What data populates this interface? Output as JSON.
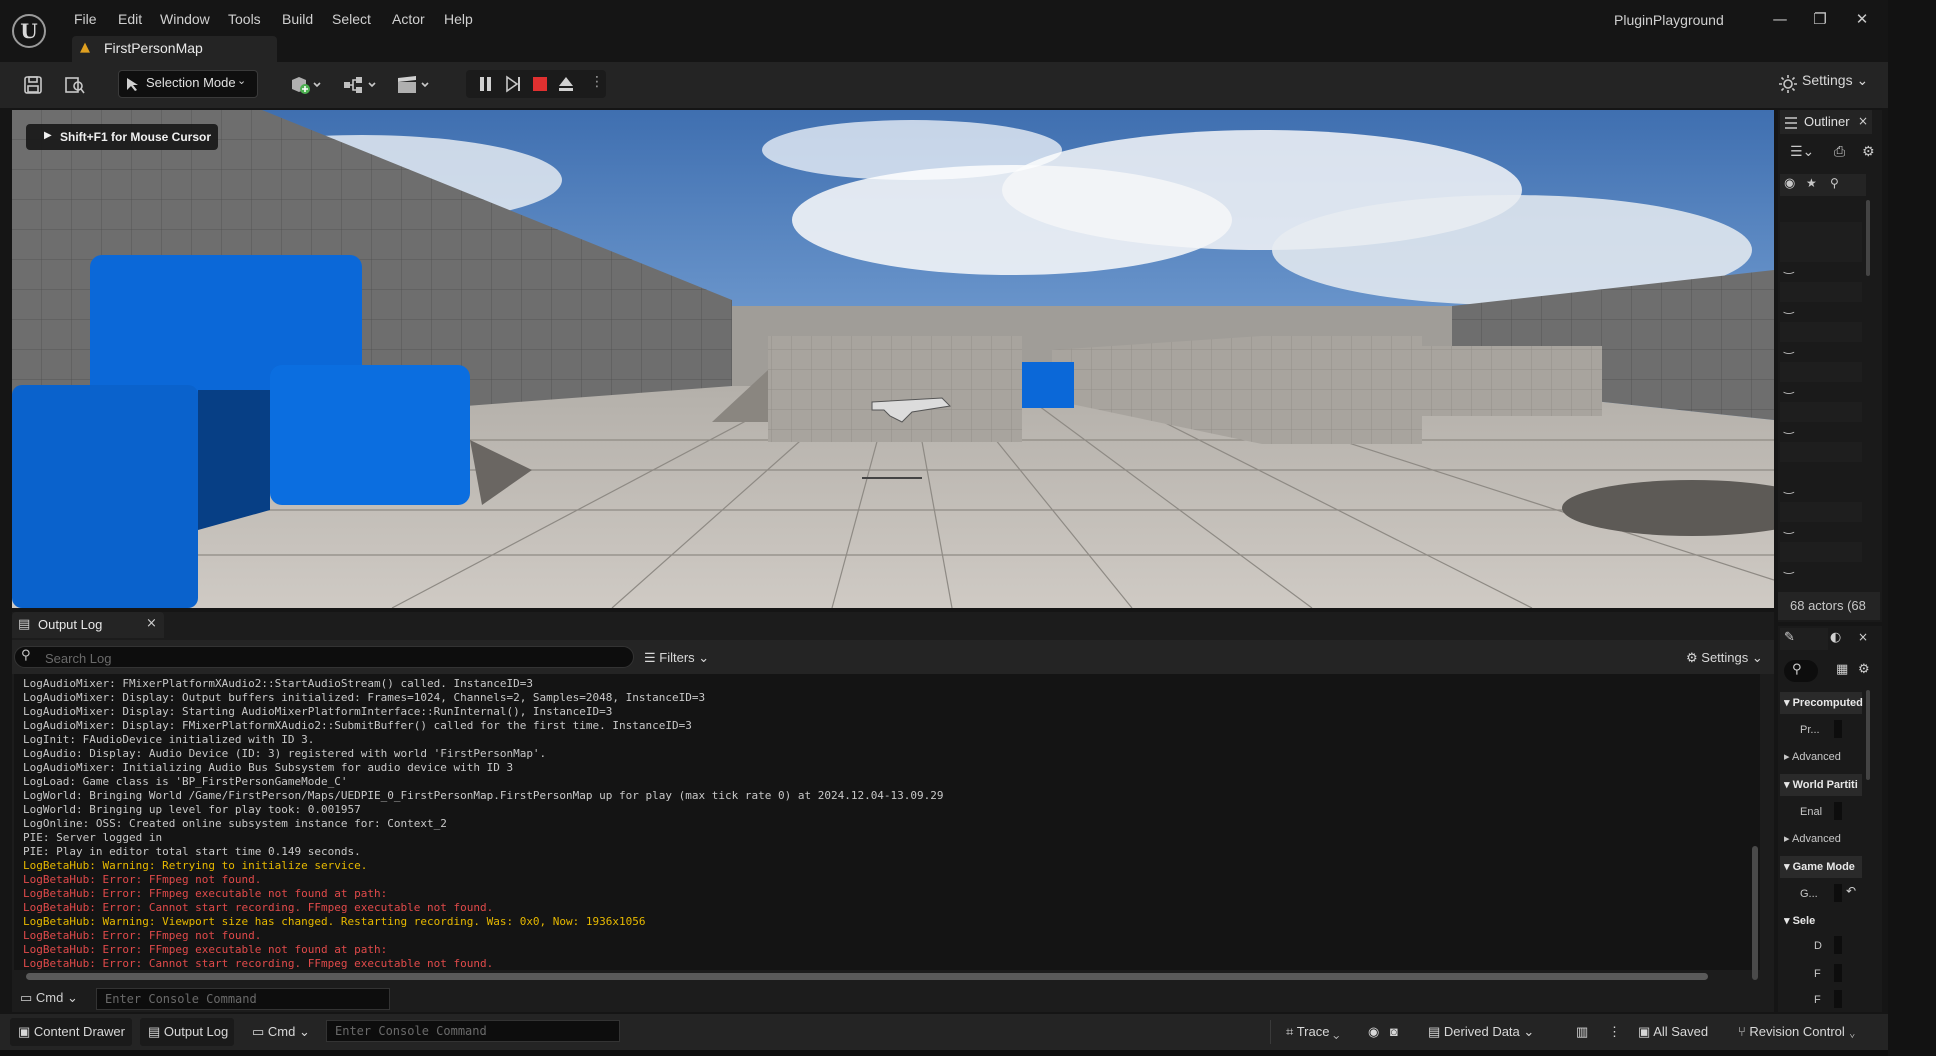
{
  "menu": [
    "File",
    "Edit",
    "Window",
    "Tools",
    "Build",
    "Select",
    "Actor",
    "Help"
  ],
  "tab": {
    "label": "FirstPersonMap"
  },
  "project_name": "PluginPlayground",
  "window_buttons": {
    "minimize": "—",
    "restore": "❐",
    "close": "✕"
  },
  "toolbar": {
    "selection_mode": "Selection Mode",
    "settings": "Settings"
  },
  "viewport": {
    "hint": "Shift+F1 for Mouse Cursor"
  },
  "outliner": {
    "title": "Outliner",
    "actor_count": "68 actors (68"
  },
  "details": {
    "sections": [
      {
        "header": "Precomputed",
        "rows": [
          "Pr..."
        ],
        "advanced": "Advanced"
      },
      {
        "header": "World Partiti",
        "rows": [
          "Enal"
        ],
        "advanced": "Advanced"
      },
      {
        "header": "Game Mode",
        "rows": [
          "G..."
        ]
      },
      {
        "header": "Sele",
        "rows": [
          "D",
          "F",
          "F"
        ]
      }
    ]
  },
  "output_log": {
    "tab_label": "Output Log",
    "search_placeholder": "Search Log",
    "filters": "Filters",
    "settings": "Settings",
    "lines": [
      {
        "text": "LogAudioMixer: FMixerPlatformXAudio2::StartAudioStream() called. InstanceID=3",
        "level": "log"
      },
      {
        "text": "LogAudioMixer: Display: Output buffers initialized: Frames=1024, Channels=2, Samples=2048, InstanceID=3",
        "level": "log"
      },
      {
        "text": "LogAudioMixer: Display: Starting AudioMixerPlatformInterface::RunInternal(), InstanceID=3",
        "level": "log"
      },
      {
        "text": "LogAudioMixer: Display: FMixerPlatformXAudio2::SubmitBuffer() called for the first time. InstanceID=3",
        "level": "log"
      },
      {
        "text": "LogInit: FAudioDevice initialized with ID 3.",
        "level": "log"
      },
      {
        "text": "LogAudio: Display: Audio Device (ID: 3) registered with world 'FirstPersonMap'.",
        "level": "log"
      },
      {
        "text": "LogAudioMixer: Initializing Audio Bus Subsystem for audio device with ID 3",
        "level": "log"
      },
      {
        "text": "LogLoad: Game class is 'BP_FirstPersonGameMode_C'",
        "level": "log"
      },
      {
        "text": "LogWorld: Bringing World /Game/FirstPerson/Maps/UEDPIE_0_FirstPersonMap.FirstPersonMap up for play (max tick rate 0) at 2024.12.04-13.09.29",
        "level": "log"
      },
      {
        "text": "LogWorld: Bringing up level for play took: 0.001957",
        "level": "log"
      },
      {
        "text": "LogOnline: OSS: Created online subsystem instance for: Context_2",
        "level": "log"
      },
      {
        "text": "PIE: Server logged in",
        "level": "log"
      },
      {
        "text": "PIE: Play in editor total start time 0.149 seconds.",
        "level": "log"
      },
      {
        "text": "LogBetaHub: Warning: Retrying to initialize service.",
        "level": "warning"
      },
      {
        "text": "LogBetaHub: Error: FFmpeg not found.",
        "level": "error"
      },
      {
        "text": "LogBetaHub: Error: FFmpeg executable not found at path:",
        "level": "error"
      },
      {
        "text": "LogBetaHub: Error: Cannot start recording. FFmpeg executable not found.",
        "level": "error"
      },
      {
        "text": "LogBetaHub: Warning: Viewport size has changed. Restarting recording. Was: 0x0, Now: 1936x1056",
        "level": "warning"
      },
      {
        "text": "LogBetaHub: Error: FFmpeg not found.",
        "level": "error"
      },
      {
        "text": "LogBetaHub: Error: FFmpeg executable not found at path:",
        "level": "error"
      },
      {
        "text": "LogBetaHub: Error: Cannot start recording. FFmpeg executable not found.",
        "level": "error"
      }
    ],
    "cmd_label": "Cmd",
    "console_placeholder": "Enter Console Command"
  },
  "statusbar": {
    "content_drawer": "Content Drawer",
    "output_log": "Output Log",
    "cmd": "Cmd",
    "console_placeholder": "Enter Console Command",
    "trace": "Trace",
    "derived_data": "Derived Data",
    "all_saved": "All Saved",
    "revision_control": "Revision Control"
  },
  "colors": {
    "log": "#c8c8c8",
    "warning": "#e6b800",
    "error": "#e04a4a",
    "stop_button": "#e03030",
    "blue_blocks": "#0b68d8"
  }
}
